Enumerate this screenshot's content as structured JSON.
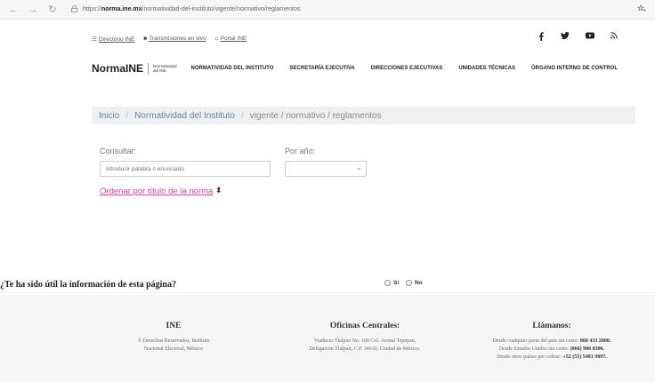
{
  "browser": {
    "url_prefix": "https://",
    "url_host": "norma.ine.mx",
    "url_path": "/normatividad-del-instituto/vigente/normativo/reglamentos",
    "back_icon": "←",
    "forward_icon": "→",
    "reload_icon": "↻"
  },
  "util": {
    "directorio": "Directorio INE",
    "transmisiones": "Transmisiones en vivo",
    "portal": "Portal INE"
  },
  "social": [
    "f",
    "t",
    "yt",
    "rss"
  ],
  "nav": {
    "logo": "NormaINE",
    "logo_sub_1": "Normatividad",
    "logo_sub_2": "del INE",
    "items": [
      "NORMATIVIDAD DEL INSTITUTO",
      "SECRETARÍA EJECUTIVA",
      "DIRECCIONES EJECUTIVAS",
      "UNIDADES TÉCNICAS",
      "ÓRGANO INTERNO DE CONTROL"
    ]
  },
  "breadcrumb": {
    "inicio": "Inicio",
    "sep": "/",
    "normatividad": "Normatividad del Instituto",
    "current": "vigente / normativo / reglamentos"
  },
  "form": {
    "consultar_label": "Consultar:",
    "search_placeholder": "Introducir palabra o enunciado",
    "year_label": "Por año:",
    "year_value": "",
    "order_link": "Ordenar por título de la norma"
  },
  "feedback": {
    "question": "¿Te ha sido útil la información de esta página?",
    "yes": "Sí",
    "no": "No"
  },
  "footer": {
    "ine_title": "INE",
    "ine_line1": "© Derechos Reservados, Instituto",
    "ine_line2": "Nacional Electoral, México",
    "oficinas_title": "Oficinas Centrales:",
    "oficinas_line1": "Viaducto Tlalpan No. 100 Col. Arenal Tepepan,",
    "oficinas_line2": "Delegación Tlalpan, C.P. 14610, Ciudad de México.",
    "llamanos_title": "Llámanos:",
    "ll1_text": "Desde cualquier parte del país sin costo: ",
    "ll1_num": "800 433 2000.",
    "ll2_text": "Desde Estados Unidos sin costo: ",
    "ll2_num": "(866) 986 8306.",
    "ll3_text": "Desde otros países por cobrar: ",
    "ll3_num": "+52 (55) 5481 9897."
  }
}
